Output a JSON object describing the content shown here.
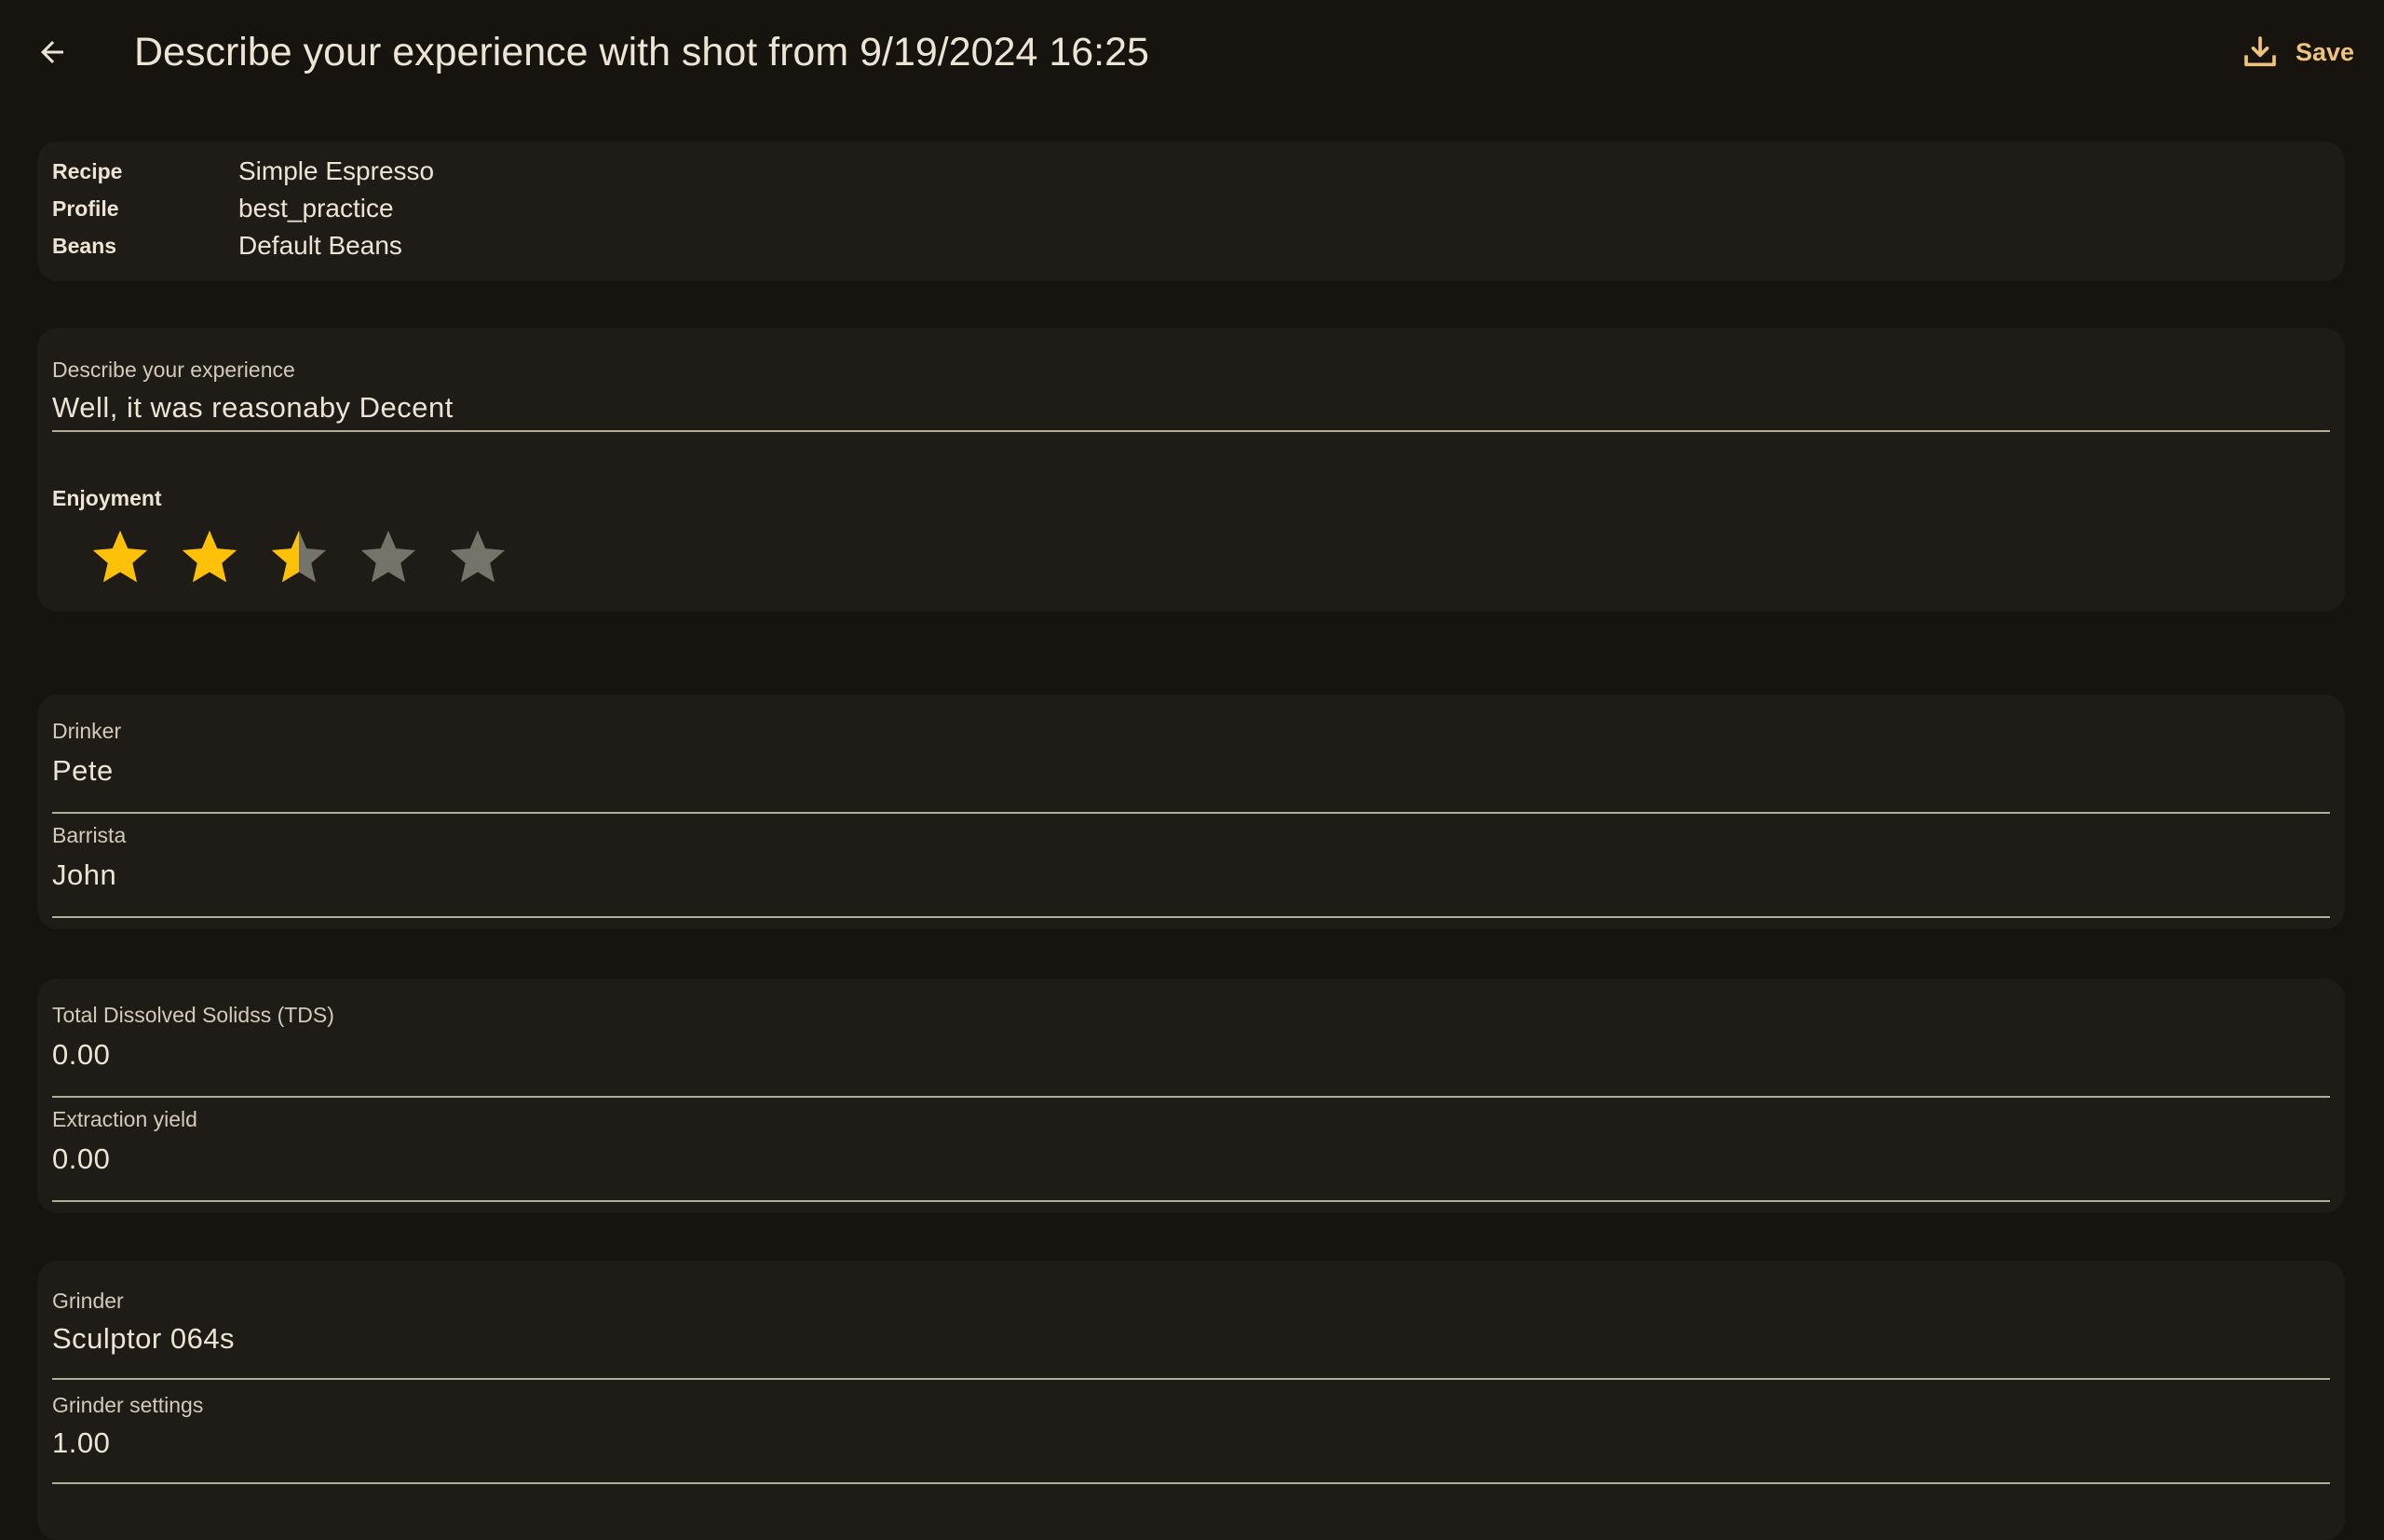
{
  "header": {
    "title": "Describe your experience with shot from 9/19/2024 16:25",
    "back_icon": "arrow-left-icon",
    "save_icon": "download-icon",
    "save_label": "Save",
    "accent_color": "#f0c37a"
  },
  "shot_info": {
    "rows": [
      {
        "label": "Recipe",
        "value": "Simple Espresso"
      },
      {
        "label": "Profile",
        "value": "best_practice"
      },
      {
        "label": "Beans",
        "value": "Default Beans"
      }
    ]
  },
  "experience": {
    "label": "Describe your experience",
    "value": "Well, it was reasonaby Decent",
    "enjoyment_label": "Enjoyment",
    "enjoyment_rating": 2.5,
    "enjoyment_max": 5,
    "star_filled_color": "#ffc107",
    "star_empty_color": "#76736b"
  },
  "people": {
    "drinker_label": "Drinker",
    "drinker_value": "Pete",
    "barista_label": "Barrista",
    "barista_value": "John"
  },
  "measurements": {
    "tds_label": "Total Dissolved Solidss (TDS)",
    "tds_value": "0.00",
    "ey_label": "Extraction yield",
    "ey_value": "0.00"
  },
  "grinder": {
    "grinder_label": "Grinder",
    "grinder_value": "Sculptor 064s",
    "settings_label": "Grinder settings",
    "settings_value": "1.00"
  }
}
